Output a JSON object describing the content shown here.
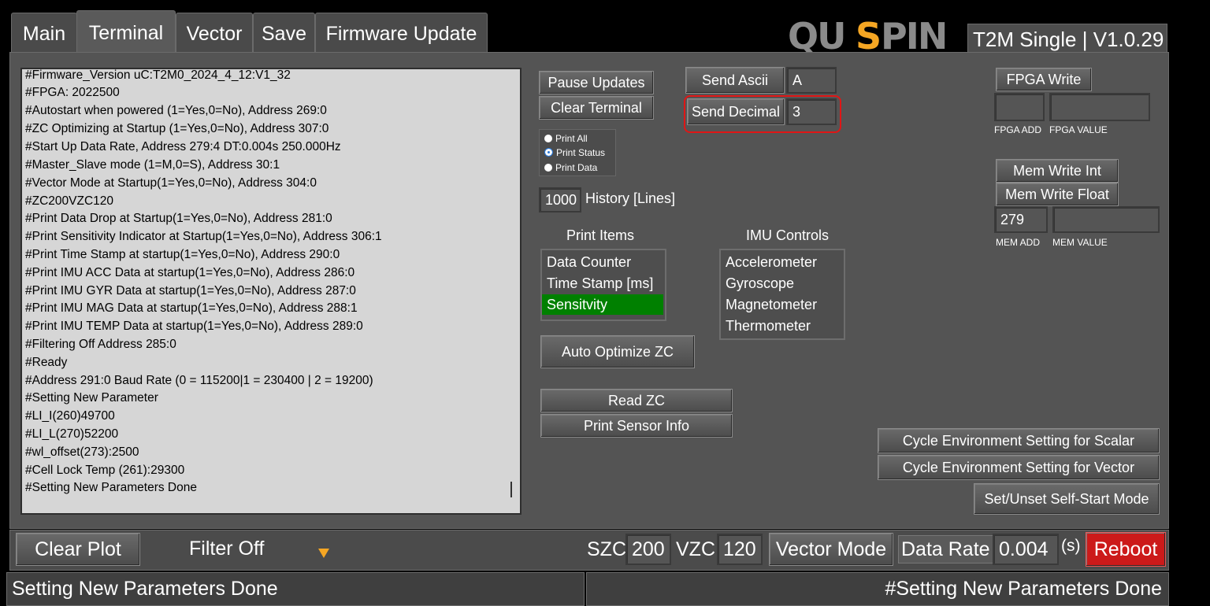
{
  "tabs": [
    "Main",
    "Terminal",
    "Vector",
    "Save",
    "Firmware Update"
  ],
  "brand": {
    "logo": "QUSPIN",
    "title": "T2M Single | V1.0.29",
    "accent": "#f5a623"
  },
  "terminal": {
    "lines": [
      "#Firmware_Version uC:T2M0_2024_4_12:V1_32",
      "#FPGA: 2022500",
      "#Autostart when powered (1=Yes,0=No), Address 269:0",
      "#ZC Optimizing at Startup (1=Yes,0=No), Address 307:0",
      "#Start Up Data Rate, Address 279:4  DT:0.004s 250.000Hz",
      "#Master_Slave mode (1=M,0=S), Address 30:1",
      "#Vector Mode at Startup(1=Yes,0=No), Address 304:0",
      "#ZC200VZC120",
      "#Print Data Drop at Startup(1=Yes,0=No), Address 281:0",
      "#Print Sensitivity Indicator at Startup(1=Yes,0=No), Address 306:1",
      "#Print Time Stamp at startup(1=Yes,0=No), Address 290:0",
      "#Print IMU ACC Data at startup(1=Yes,0=No), Address 286:0",
      "#Print IMU GYR Data at startup(1=Yes,0=No), Address 287:0",
      "#Print IMU MAG Data at startup(1=Yes,0=No), Address 288:1",
      "#Print IMU TEMP Data at startup(1=Yes,0=No), Address 289:0",
      "#Filtering Off  Address 285:0",
      "#Ready",
      "#Address 291:0  Baud Rate (0 = 115200|1 = 230400 | 2 = 19200)",
      "#Setting New Parameter",
      "#LI_I(260)49700",
      "#LI_L(270)52200",
      "#wl_offset(273):2500",
      "#Cell Lock Temp (261):29300",
      "#Setting New Parameters Done"
    ]
  },
  "controls": {
    "pause_updates": "Pause Updates",
    "clear_terminal": "Clear Terminal",
    "print_modes": [
      "Print All",
      "Print Status",
      "Print Data"
    ],
    "print_mode_selected": "Print Status",
    "history_value": "1000",
    "history_label": "History [Lines]",
    "send_ascii": "Send Ascii",
    "send_ascii_value": "A",
    "send_decimal": "Send Decimal",
    "send_decimal_value": "3",
    "print_items_label": "Print Items",
    "print_items": [
      "Data Counter",
      "Time Stamp [ms]",
      "Sensitvity"
    ],
    "print_items_selected": "Sensitvity",
    "imu_controls_label": "IMU Controls",
    "imu_controls": [
      "Accelerometer",
      "Gyroscope",
      "Magnetometer",
      "Thermometer"
    ],
    "auto_optimize": "Auto Optimize ZC",
    "read_zc": "Read ZC",
    "print_sensor_info": "Print Sensor Info",
    "fpga_write": "FPGA Write",
    "fpga_add_label": "FPGA ADD",
    "fpga_value_label": "FPGA VALUE",
    "mem_write_int": "Mem Write Int",
    "mem_write_float": "Mem Write Float",
    "mem_add_value": "279",
    "mem_add_label": "MEM ADD",
    "mem_value_label": "MEM VALUE",
    "cycle_scalar": "Cycle Environment Setting for Scalar",
    "cycle_vector": "Cycle Environment Setting for Vector",
    "self_start": "Set/Unset Self-Start Mode",
    "selected_color": "#008000"
  },
  "bottom": {
    "clear_plot": "Clear Plot",
    "filter": "Filter Off",
    "szc_label": "SZC",
    "szc_value": "200",
    "vzc_label": "VZC",
    "vzc_value": "120",
    "vector_mode": "Vector Mode",
    "data_rate_label": "Data Rate",
    "data_rate_value": "0.004",
    "data_rate_unit": "(s)",
    "reboot": "Reboot",
    "reboot_color": "#cc1a1a"
  },
  "status": {
    "left": "Setting New Parameters Done",
    "right": "#Setting New Parameters Done"
  }
}
